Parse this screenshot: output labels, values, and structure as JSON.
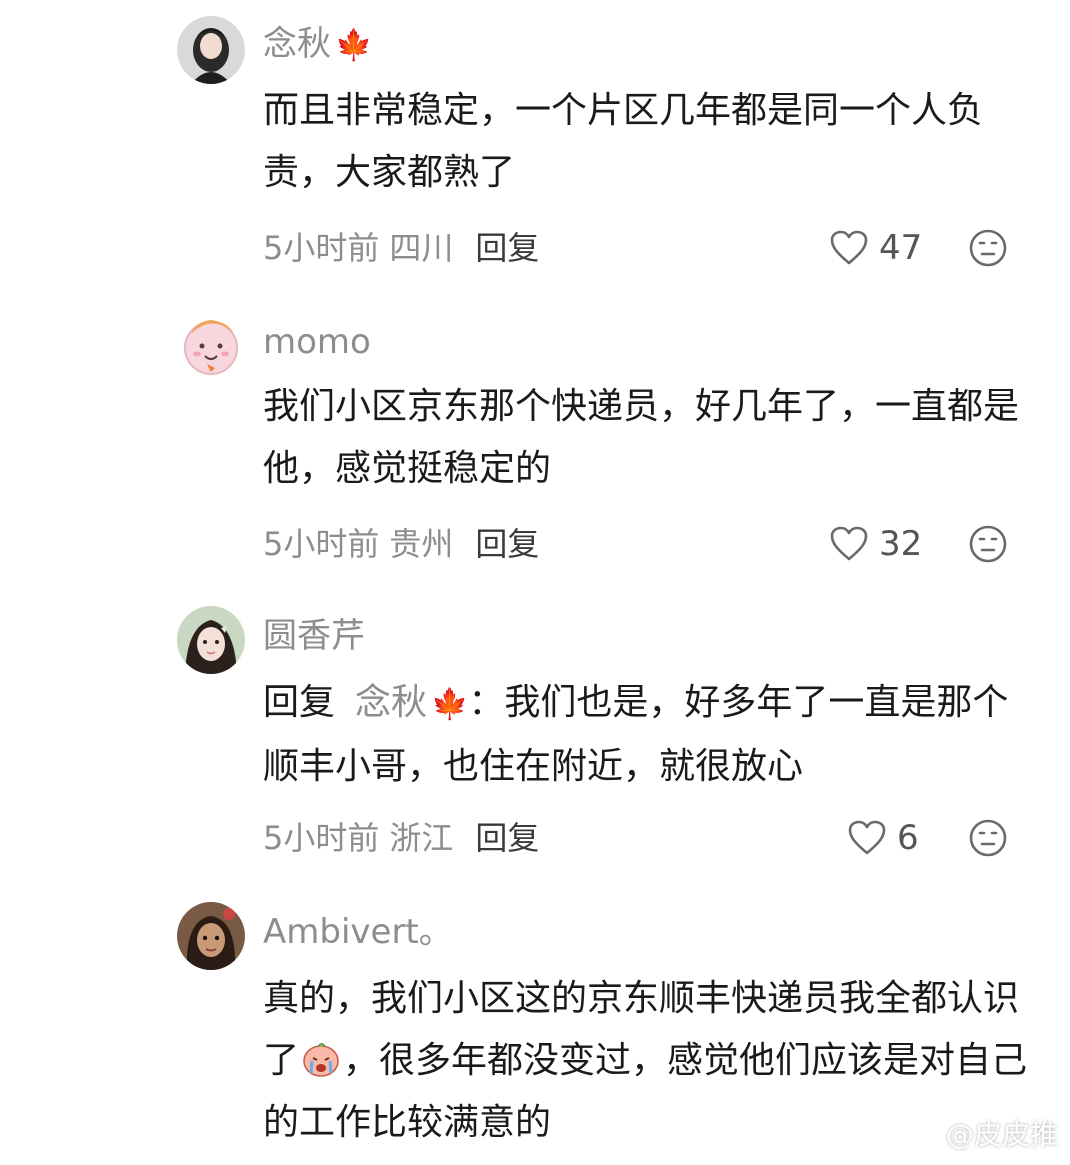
{
  "comments": [
    {
      "username": "念秋",
      "name_emoji": "🍁",
      "text": "而且非常稳定，一个片区几年都是同一个人负责，大家都熟了",
      "time": "5小时前",
      "location": "四川",
      "reply_label": "回复",
      "likes": "47"
    },
    {
      "username": "momo",
      "text": "我们小区京东那个快递员，好几年了，一直都是他，感觉挺稳定的",
      "time": "5小时前",
      "location": "贵州",
      "reply_label": "回复",
      "likes": "32"
    },
    {
      "username": "圆香芹",
      "reply_prefix": "回复",
      "reply_target": "念秋",
      "reply_target_emoji": "🍁",
      "reply_colon": "：",
      "text": "我们也是，好多年了一直是那个顺丰小哥，也住在附近，就很放心",
      "time": "5小时前",
      "location": "浙江",
      "reply_label": "回复",
      "likes": "6"
    },
    {
      "username": "Ambivert。",
      "text_before_emoji": "真的，我们小区这的京东顺丰快递员我全都认识了",
      "text_after_emoji": "，很多年都没变过，感觉他们应该是对自己的工作比较满意的"
    }
  ],
  "watermark": "@皮皮推",
  "icons": {
    "like": "heart-outline-icon",
    "dislike": "neutral-face-icon",
    "watermark": "weibo-logo-icon",
    "inline_emoji": "crying-face-emoji-icon"
  },
  "colors": {
    "username": "#8d8d8d",
    "text": "#1a1a1a",
    "meta": "#8d8d8d",
    "maple": "#d9401e"
  }
}
